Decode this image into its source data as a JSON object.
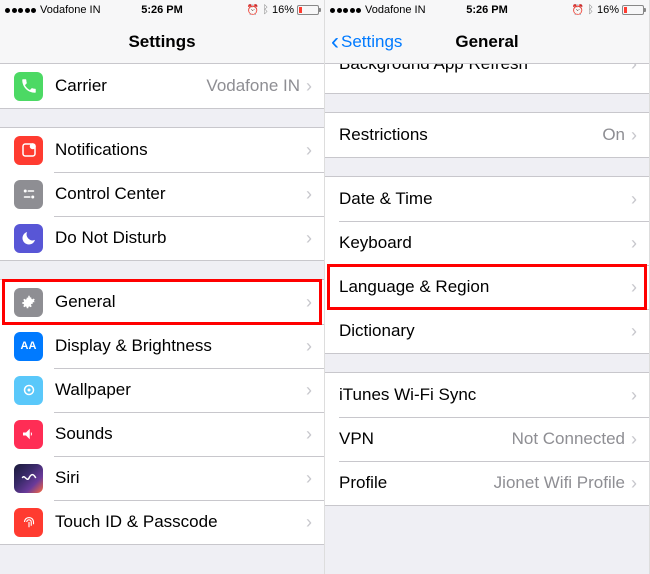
{
  "status": {
    "carrier": "Vodafone IN",
    "time": "5:26 PM",
    "battery_pct": "16%"
  },
  "left": {
    "nav_title": "Settings",
    "groups": [
      {
        "cells": [
          {
            "id": "carrier",
            "label": "Carrier",
            "value": "Vodafone IN",
            "icon": "phone-icon",
            "icon_class": "ic-green"
          }
        ]
      },
      {
        "cells": [
          {
            "id": "notifications",
            "label": "Notifications",
            "icon": "notifications-icon",
            "icon_class": "ic-red"
          },
          {
            "id": "control-center",
            "label": "Control Center",
            "icon": "control-center-icon",
            "icon_class": "ic-gray"
          },
          {
            "id": "dnd",
            "label": "Do Not Disturb",
            "icon": "moon-icon",
            "icon_class": "ic-indigo"
          }
        ]
      },
      {
        "cells": [
          {
            "id": "general",
            "label": "General",
            "icon": "gear-icon",
            "icon_class": "ic-graygear",
            "highlight": true
          },
          {
            "id": "display",
            "label": "Display & Brightness",
            "icon": "display-icon",
            "icon_class": "ic-blue"
          },
          {
            "id": "wallpaper",
            "label": "Wallpaper",
            "icon": "wallpaper-icon",
            "icon_class": "ic-cyan"
          },
          {
            "id": "sounds",
            "label": "Sounds",
            "icon": "sounds-icon",
            "icon_class": "ic-pink"
          },
          {
            "id": "siri",
            "label": "Siri",
            "icon": "siri-icon",
            "icon_class": "ic-siri"
          },
          {
            "id": "touchid",
            "label": "Touch ID & Passcode",
            "icon": "fingerprint-icon",
            "icon_class": "ic-redfp"
          }
        ]
      }
    ]
  },
  "right": {
    "nav_back": "Settings",
    "nav_title": "General",
    "partial_top": "Background App Refresh",
    "groups": [
      {
        "cells": [
          {
            "id": "restrictions",
            "label": "Restrictions",
            "value": "On"
          }
        ]
      },
      {
        "cells": [
          {
            "id": "date-time",
            "label": "Date & Time"
          },
          {
            "id": "keyboard",
            "label": "Keyboard"
          },
          {
            "id": "language-region",
            "label": "Language & Region",
            "highlight": true
          },
          {
            "id": "dictionary",
            "label": "Dictionary"
          }
        ]
      },
      {
        "cells": [
          {
            "id": "itunes-wifi",
            "label": "iTunes Wi-Fi Sync"
          },
          {
            "id": "vpn",
            "label": "VPN",
            "value": "Not Connected"
          },
          {
            "id": "profile",
            "label": "Profile",
            "value": "Jionet Wifi Profile"
          }
        ]
      }
    ]
  }
}
